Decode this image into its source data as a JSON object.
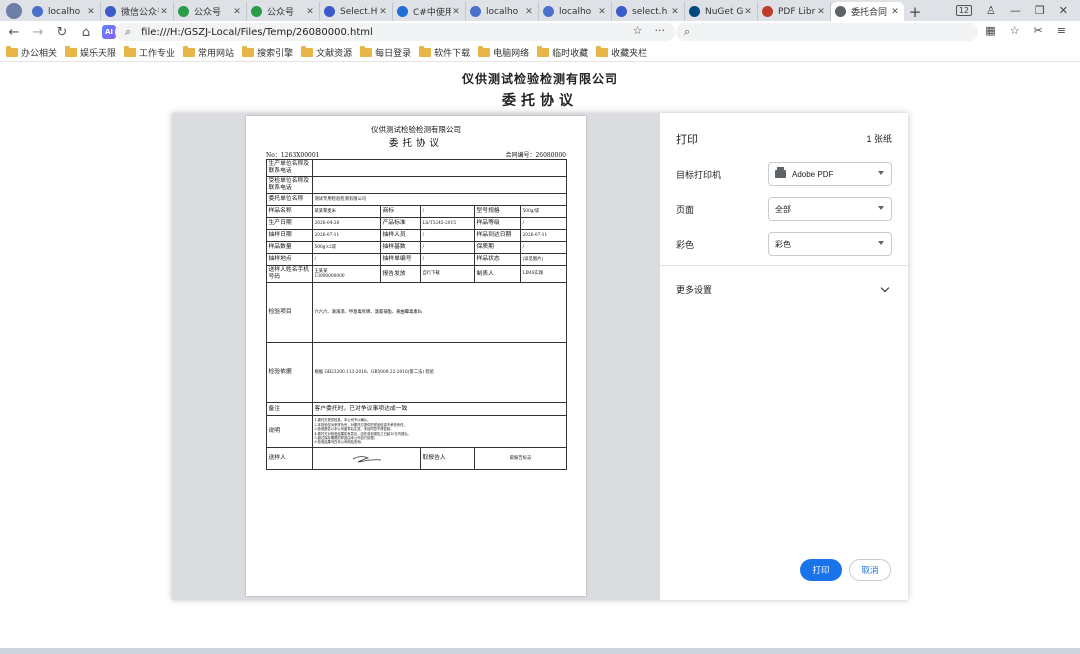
{
  "browser": {
    "tabs": [
      {
        "label": "localho",
        "icon": "globe-icon",
        "color": "#4a70c9"
      },
      {
        "label": "微信公众号",
        "icon": "gear-icon",
        "color": "#3b5bc9"
      },
      {
        "label": "公众号",
        "icon": "recycle-icon",
        "color": "#2a9d4a"
      },
      {
        "label": "公众号",
        "icon": "recycle-icon",
        "color": "#2a9d4a"
      },
      {
        "label": "Select.H",
        "icon": "gear-icon",
        "color": "#3b5bc9"
      },
      {
        "label": "C#中使用",
        "icon": "c-icon",
        "color": "#1f6fd6"
      },
      {
        "label": "localho",
        "icon": "globe-icon",
        "color": "#4a70c9"
      },
      {
        "label": "localho",
        "icon": "globe-icon",
        "color": "#4a70c9"
      },
      {
        "label": "select.h",
        "icon": "gear-icon",
        "color": "#3b5bc9"
      },
      {
        "label": "NuGet G",
        "icon": "nuget-icon",
        "color": "#004880"
      },
      {
        "label": "PDF Libr",
        "icon": "document-icon",
        "color": "#c0392b"
      },
      {
        "label": "委托合同",
        "icon": "globe-icon",
        "color": "#5f6368",
        "active": true
      }
    ],
    "new_tab": "+",
    "tab_count_badge": "12",
    "url": "file:///H:/GSZJ-Local/Files/Temp/26080000.html",
    "ai_label": "AI"
  },
  "bookmarks": [
    "办公相关",
    "娱乐天限",
    "工作专业",
    "常用网站",
    "搜索引擎",
    "文献资源",
    "每日登录",
    "软件下载",
    "电脑网络",
    "临时收藏",
    "收藏夹栏"
  ],
  "background_page": {
    "company": "仪供测试检验检测有限公司",
    "title": "委托协议"
  },
  "document": {
    "company": "仪供测试检验检测有限公司",
    "title": "委托协议",
    "no_label": "No：1263X00001",
    "contract_label": "合同编号：26080000",
    "producer_label": "生产单位名称及联系电话",
    "testee_label": "受检单位名称及联系电话",
    "client_label": "委托单位名称",
    "client_value": "测试专用检验检测有限公司",
    "sample_name_label": "样品名称",
    "sample_name_value": "某某黎麦米",
    "brand_label": "商标",
    "brand_value": "/",
    "spec_label": "型号规格",
    "spec_value": "500g/袋",
    "prod_date_label": "生产日期",
    "prod_date_value": "2026-04-28",
    "standard_label": "产品标准",
    "standard_value": "LS/T3245-2015",
    "grade_label": "样品等级",
    "grade_value": "/",
    "sample_date_label": "抽样日期",
    "sample_date_value": "2026-07-11",
    "sampler_label": "抽样人员",
    "sampler_value": "/",
    "arrive_label": "样品到达日期",
    "arrive_value": "2026-07-11",
    "qty_label": "样品数量",
    "qty_value": "500g×2袋",
    "base_label": "抽样基数",
    "base_value": "/",
    "shelf_label": "保质期",
    "shelf_value": "/",
    "place_label": "抽样地点",
    "place_value": "/",
    "sheet_no_label": "抽样单编号",
    "sheet_no_value": "/",
    "state_label": "样品状态",
    "state_value": "(详见图片)",
    "sender_label": "送样人姓名手机号码",
    "sender_name": "王某某",
    "sender_phone": "13900000000",
    "report_label": "报告发放",
    "report_value": "自行下载",
    "maker_label": "制表人",
    "maker_value": "LIMS实践",
    "items_label": "检验项目",
    "items_value": "六六六、滴滴涕、甲基毒死蜱、溴氰菊酯、黄曲霉毒素B₁",
    "basis_label": "检验依据",
    "basis_value": "根据 GB23200.113-2018、GB5009.22-2016(第二法) 检验",
    "remark_label": "备注",
    "remark_value": "客户委托时，已对争议事项达成一致",
    "note_label": "说明",
    "note_lines": [
      "1.委托方提供信息，本公司予以确认。",
      "2.本检验仅对来样负责，对委托方提供的样品信息不承担责任。",
      "3.检验报告以本公司盖章后生效，未经同意不得复制。",
      "4.委托方对检验结果如有异议，应在收到报告之日起15日内提出。",
      "5.超过保存期限的样品由本公司自行处理。",
      "6.检验结果可在本公司网站查询。"
    ],
    "deliverer_label": "送样人",
    "receiver_label": "取报告人",
    "receipt_label": "取报告标志"
  },
  "print_settings": {
    "title": "打印",
    "sheets": "1 张纸",
    "destination_label": "目标打印机",
    "destination_value": "Adobe PDF",
    "pages_label": "页面",
    "pages_value": "全部",
    "color_label": "彩色",
    "color_value": "彩色",
    "more_settings": "更多设置",
    "print_button": "打印",
    "cancel_button": "取消",
    "accent_color": "#1a73e8"
  }
}
